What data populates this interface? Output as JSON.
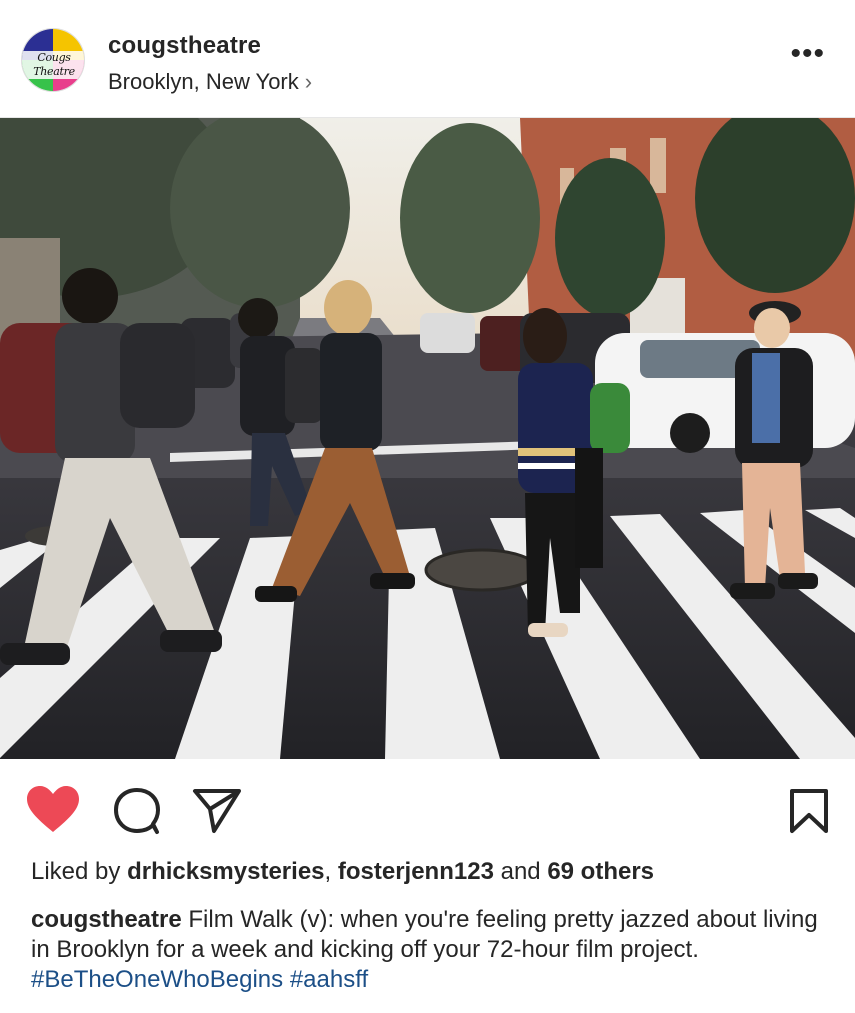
{
  "post": {
    "username": "cougstheatre",
    "location": "Brooklyn, New York",
    "avatar_text": "Cougs Theatre",
    "photo_alt": "Film Walk group photo"
  },
  "likes": {
    "prefix": "Liked by",
    "user1": "drhicksmysteries",
    "sep": ",",
    "user2": "fosterjenn123",
    "and": "and",
    "others": "69 others"
  },
  "caption": {
    "username": "cougstheatre",
    "text": "Film Walk (v): when you're feeling pretty jazzed about living in Brooklyn for a week and kicking off your 72-hour film project.",
    "hashtags": [
      "#BeTheOneWhoBegins",
      "#aahsff"
    ]
  },
  "colors": {
    "heart": "#ed4956",
    "hashtag": "#1c4f87",
    "text": "#262626"
  },
  "icons": [
    "more-options-icon",
    "heart-icon",
    "comment-icon",
    "share-icon",
    "bookmark-icon",
    "location-chevron-icon"
  ]
}
